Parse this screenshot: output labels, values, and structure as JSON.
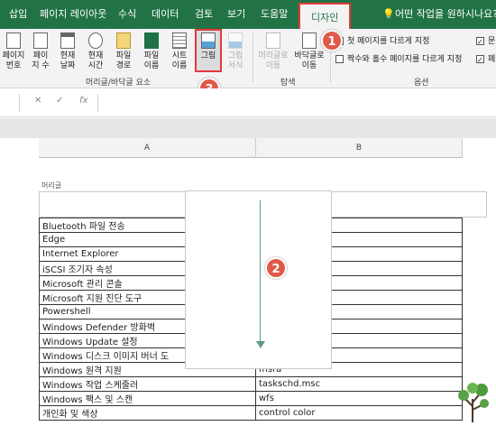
{
  "tabs": [
    {
      "label": "삽입"
    },
    {
      "label": "페이지 레이아웃"
    },
    {
      "label": "수식"
    },
    {
      "label": "데이터"
    },
    {
      "label": "검토"
    },
    {
      "label": "보기"
    },
    {
      "label": "도움말"
    },
    {
      "label": "디자인"
    }
  ],
  "tell_me": "어떤 작업을 원하시나요?",
  "ribbon": {
    "buttons": [
      {
        "line1": "페이지",
        "line2": "번호"
      },
      {
        "line1": "페이",
        "line2": "지 수"
      },
      {
        "line1": "현재",
        "line2": "날짜"
      },
      {
        "line1": "현재",
        "line2": "시간"
      },
      {
        "line1": "파일",
        "line2": "경로"
      },
      {
        "line1": "파일",
        "line2": "이름"
      },
      {
        "line1": "시트",
        "line2": "이름"
      },
      {
        "line1": "그림",
        "line2": ""
      },
      {
        "line1": "그림",
        "line2": "서식"
      },
      {
        "line1": "머리글로",
        "line2": "이동"
      },
      {
        "line1": "바닥글로",
        "line2": "이동"
      }
    ],
    "group_elements": "머리글/바닥글 요소",
    "group_nav": "탐색",
    "group_options": "옵션",
    "option_first_page": "첫 페이지를 다르게 지정",
    "option_odd_even": "짝수와 홀수 페이지를 다르게 지정",
    "option_doc": "문서",
    "option_page": "페이"
  },
  "badges": [
    "1",
    "2",
    "3"
  ],
  "formula_bar": {
    "cancel": "✕",
    "enter": "✓",
    "fx": "fx"
  },
  "columns": [
    "A",
    "B"
  ],
  "header_label": "머리글",
  "rows": [
    {
      "a": "Bluetooth 파일 전송",
      "b": ""
    },
    {
      "a": "Edge",
      "b": "y"
    },
    {
      "a": "Internet Explorer",
      "b": ""
    },
    {
      "a": "iSCSI 조기자 속성",
      "b": ""
    },
    {
      "a": "Microsoft 관리 콘솔",
      "b": ""
    },
    {
      "a": "Microsoft 지원 진단 도구",
      "b": ""
    },
    {
      "a": "Powershell",
      "b": ""
    },
    {
      "a": "Windows Defender 방화벽",
      "b": ""
    },
    {
      "a": "Windows Update 설정",
      "b": ""
    },
    {
      "a": "Windows 디스크 이미지 버너 도",
      "b": ""
    },
    {
      "a": "Windows 원격 지원",
      "b": "msra"
    },
    {
      "a": "Windows 작업 스케줄러",
      "b": "taskschd.msc"
    },
    {
      "a": "Windows 팩스 및 스캔",
      "b": "wfs"
    },
    {
      "a": "개인화 및 색상",
      "b": "control color"
    }
  ],
  "colors": {
    "brand": "#217346",
    "highlight": "#e23a3a",
    "badge": "#e05a4a"
  }
}
